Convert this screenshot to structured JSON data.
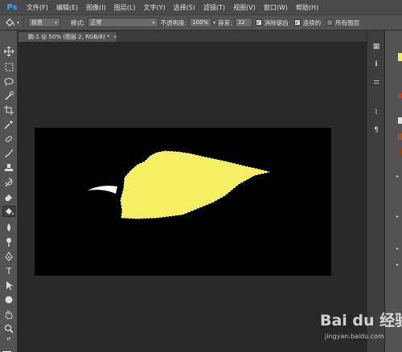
{
  "app": {
    "logo": "Ps"
  },
  "menu": [
    "文件(F)",
    "编辑(E)",
    "图像(I)",
    "图层(L)",
    "文字(Y)",
    "选择(S)",
    "滤镜(T)",
    "视图(V)",
    "窗口(W)",
    "帮助(H)"
  ],
  "options_bar": {
    "tool_icon": "paint-bucket-icon",
    "fill_source": "前景",
    "mode_label": "模式:",
    "mode_value": "正常",
    "opacity_label": "不透明度:",
    "opacity_value": "100%",
    "tolerance_label": "容差:",
    "tolerance_value": "32",
    "antialias_label": "消除锯齿",
    "antialias_checked": true,
    "contiguous_label": "连续的",
    "contiguous_checked": true,
    "all_layers_label": "所有图层",
    "all_layers_checked": false
  },
  "document_tab": {
    "title": "鹏-1 @ 50% (图层 2, RGB/8) *",
    "close": "×"
  },
  "colors": {
    "foreground": "#f5ef62",
    "background": "#000000",
    "leaf_fill": "#f5ef62",
    "stem_fill": "#ffffff",
    "canvas": "#000000"
  },
  "tools": [
    "move-icon",
    "marquee-icon",
    "lasso-icon",
    "quick-select-icon",
    "crop-icon",
    "eyedropper-icon",
    "healing-brush-icon",
    "brush-icon",
    "clone-stamp-icon",
    "history-brush-icon",
    "eraser-icon",
    "paint-bucket-icon",
    "blur-icon",
    "dodge-icon",
    "pen-icon",
    "type-icon",
    "path-select-icon",
    "ellipse-icon",
    "hand-icon",
    "zoom-icon"
  ],
  "watermark": {
    "brand": "Bai du 经验",
    "site": "jingyan.baidu.com"
  }
}
